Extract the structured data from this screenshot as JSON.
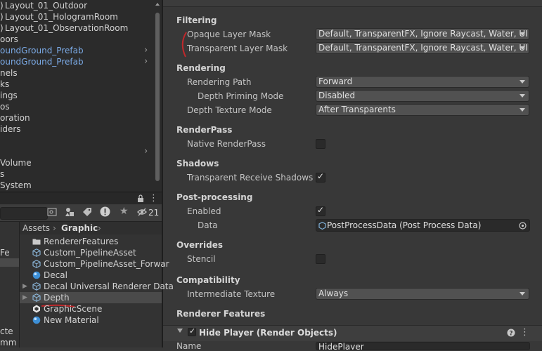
{
  "hierarchy": {
    "items": [
      {
        "label": "Layout_01_Outdoor",
        "type": "scene"
      },
      {
        "label": "Layout_01_HologramRoom",
        "type": "scene"
      },
      {
        "label": "Layout_01_ObservationRoom",
        "type": "scene"
      },
      {
        "label": "oors",
        "type": "normal"
      },
      {
        "label": "oundGround_Prefab",
        "type": "prefab"
      },
      {
        "label": "oundGround_Prefab",
        "type": "prefab"
      },
      {
        "label": "nels",
        "type": "normal"
      },
      {
        "label": "ks",
        "type": "normal"
      },
      {
        "label": "ings",
        "type": "normal"
      },
      {
        "label": "os",
        "type": "normal"
      },
      {
        "label": "oration",
        "type": "normal"
      },
      {
        "label": "iders",
        "type": "normal"
      },
      {
        "label": "",
        "type": "normal"
      },
      {
        "label": "",
        "type": "normal"
      },
      {
        "label": " Volume",
        "type": "normal"
      },
      {
        "label": "s",
        "type": "normal"
      },
      {
        "label": "System",
        "type": "normal"
      }
    ]
  },
  "project": {
    "search_count": "21",
    "breadcrumb": {
      "root": "Assets",
      "current": "Graphic"
    },
    "left_items": [
      "",
      "",
      "Fe",
      "",
      "",
      "",
      "",
      "",
      "",
      "cte",
      "mm"
    ],
    "files": [
      {
        "label": "RendererFeatures",
        "icon": "folder"
      },
      {
        "label": "Custom_PipelineAsset",
        "icon": "asset"
      },
      {
        "label": "Custom_PipelineAsset_Forwar",
        "icon": "asset"
      },
      {
        "label": "Decal",
        "icon": "material"
      },
      {
        "label": "Decal Universal Renderer Data",
        "icon": "asset"
      },
      {
        "label": "Depth",
        "icon": "asset"
      },
      {
        "label": "GraphicScene",
        "icon": "unity"
      },
      {
        "label": "New Material",
        "icon": "material"
      }
    ]
  },
  "inspector": {
    "filtering": {
      "title": "Filtering",
      "opaque_label": "Opaque Layer Mask",
      "opaque_value": "Default, TransparentFX, Ignore Raycast, Water, UI",
      "transparent_label": "Transparent Layer Mask",
      "transparent_value": "Default, TransparentFX, Ignore Raycast, Water, UI"
    },
    "rendering": {
      "title": "Rendering",
      "path_label": "Rendering Path",
      "path_value": "Forward",
      "priming_label": "Depth Priming Mode",
      "priming_value": "Disabled",
      "texture_label": "Depth Texture Mode",
      "texture_value": "After Transparents"
    },
    "renderpass": {
      "title": "RenderPass",
      "native_label": "Native RenderPass",
      "native_checked": false
    },
    "shadows": {
      "title": "Shadows",
      "receive_label": "Transparent Receive Shadows",
      "receive_checked": true
    },
    "postprocessing": {
      "title": "Post-processing",
      "enabled_label": "Enabled",
      "enabled_checked": true,
      "data_label": "Data",
      "data_value": "PostProcessData (Post Process Data)"
    },
    "overrides": {
      "title": "Overrides",
      "stencil_label": "Stencil",
      "stencil_checked": false
    },
    "compatibility": {
      "title": "Compatibility",
      "intermediate_label": "Intermediate Texture",
      "intermediate_value": "Always"
    },
    "renderer_features": {
      "title": "Renderer Features",
      "feature_title": "Hide Player (Render Objects)",
      "name_label": "Name",
      "name_value": "HidePlayer"
    }
  },
  "colors": {
    "prefab_text": "#7baae6",
    "annotation_red": "#c0282b"
  }
}
